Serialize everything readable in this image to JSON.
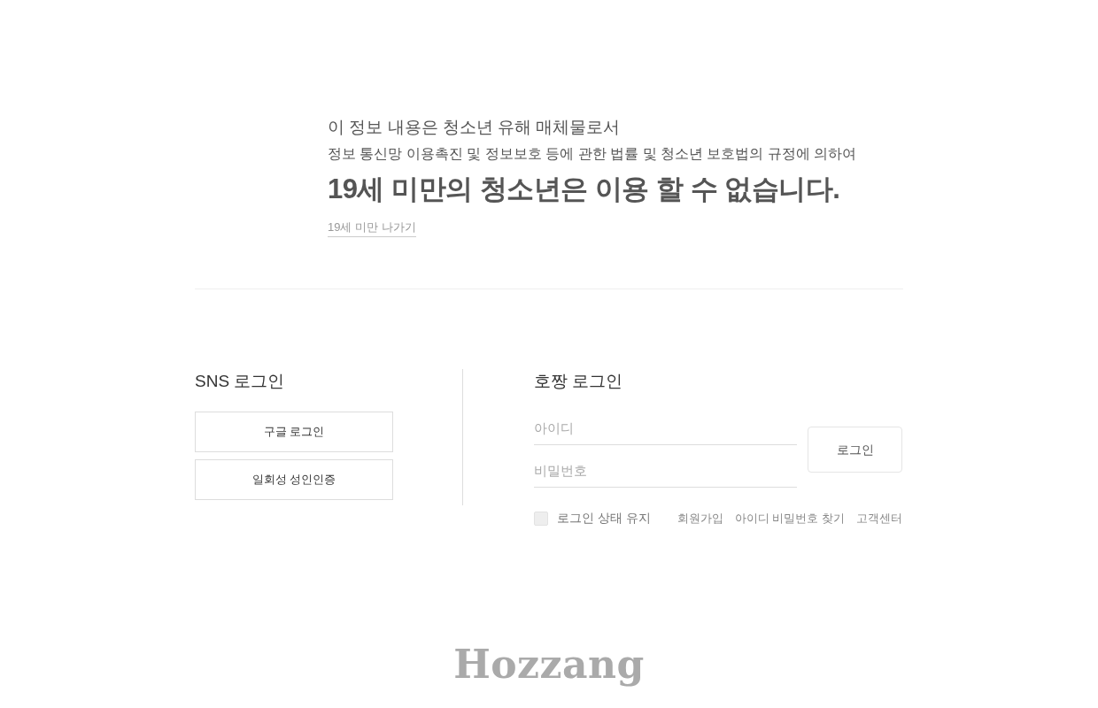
{
  "notice": {
    "line_1": "이 정보 내용은 청소년 유해 매체물로서",
    "line_2": "정보 통신망 이용촉진 및 정보보호 등에 관한 법률 및 청소년 보호법의 규정에 의하여",
    "headline": "19세 미만의 청소년은 이용 할 수 없습니다.",
    "exit_link": "19세 미만 나가기"
  },
  "sns_login": {
    "title": "SNS 로그인",
    "buttons": [
      "구글 로그인",
      "일회성 성인인증"
    ]
  },
  "member_login": {
    "title": "호짱 로그인",
    "id_field": {
      "placeholder": "아이디"
    },
    "password_field": {
      "placeholder": "비밀번호"
    },
    "login_button": "로그인",
    "keep_login": {
      "label": "로그인 상태 유지",
      "checked": false
    },
    "links": [
      "회원가입",
      "아이디 비밀번호 찾기",
      "고객센터"
    ]
  },
  "footer": {
    "logo": "Hozzang"
  }
}
